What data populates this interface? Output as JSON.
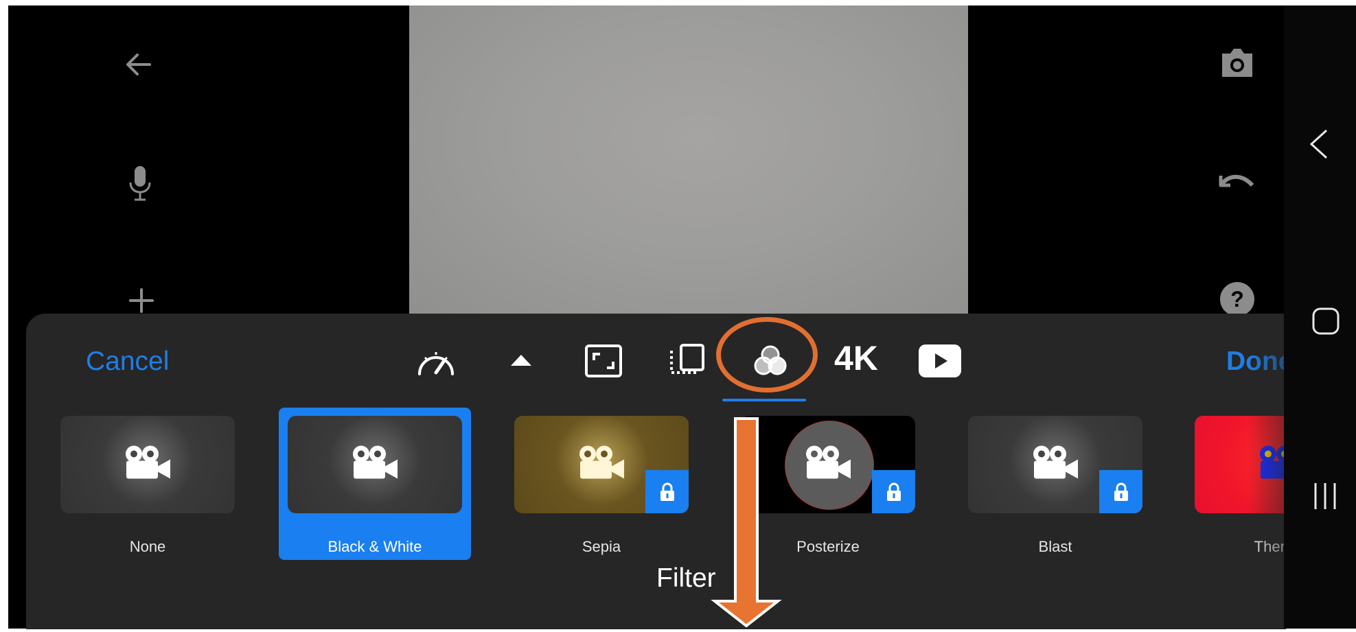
{
  "toolbar": {
    "cancel_label": "Cancel",
    "done_label": "Done",
    "resolution_label": "4K",
    "tools": [
      "speed-icon",
      "collapse-icon",
      "crop-icon",
      "flip-icon",
      "filter-icon",
      "resolution-4k",
      "play-icon"
    ]
  },
  "filters": [
    {
      "label": "None",
      "locked": false,
      "selected": false
    },
    {
      "label": "Black & White",
      "locked": false,
      "selected": true
    },
    {
      "label": "Sepia",
      "locked": true,
      "selected": false
    },
    {
      "label": "Posterize",
      "locked": true,
      "selected": false
    },
    {
      "label": "Blast",
      "locked": true,
      "selected": false
    },
    {
      "label": "Thermal",
      "locked": false,
      "selected": false
    }
  ],
  "annotation": {
    "label": "Filter",
    "color": "#e26f31"
  },
  "side_controls": {
    "left": [
      "back-arrow-icon",
      "microphone-icon",
      "add-icon"
    ],
    "right": [
      "camera-icon",
      "undo-icon",
      "help-icon"
    ]
  },
  "system_nav": [
    "nav-back-icon",
    "nav-home-icon",
    "nav-recents-icon"
  ],
  "colors": {
    "accent": "#1a7ff0",
    "panel": "#262626",
    "highlight": "#e26f31"
  }
}
